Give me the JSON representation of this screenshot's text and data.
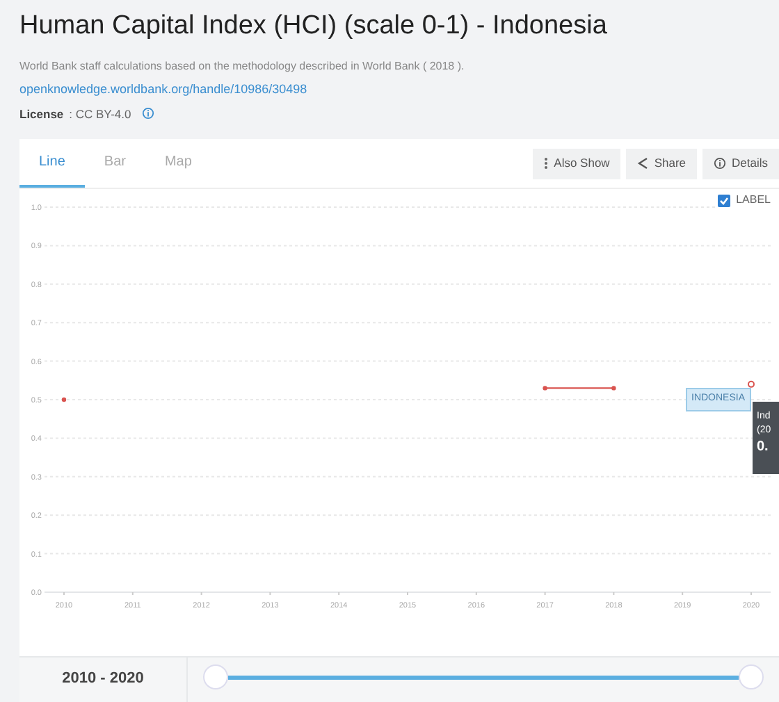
{
  "title": "Human Capital Index (HCI) (scale 0-1) - Indonesia",
  "source": "World Bank staff calculations based on the methodology described in World Bank ( 2018 ).",
  "source_link": "openknowledge.worldbank.org/handle/10986/30498",
  "license": {
    "label": "License",
    "value": ": CC BY-4.0"
  },
  "tabs": [
    {
      "label": "Line",
      "selected": true
    },
    {
      "label": "Bar",
      "selected": false
    },
    {
      "label": "Map",
      "selected": false
    }
  ],
  "actions": [
    {
      "label": "Also Show",
      "kind": "more"
    },
    {
      "label": "Share",
      "kind": "share"
    },
    {
      "label": "Details",
      "kind": "info"
    }
  ],
  "label_toggle": {
    "label": "LABEL",
    "checked": true
  },
  "chart_data": {
    "type": "line",
    "categories": [
      "2010",
      "2011",
      "2012",
      "2013",
      "2014",
      "2015",
      "2016",
      "2017",
      "2018",
      "2019",
      "2020"
    ],
    "grid": true,
    "series": [
      {
        "name": "INDONESIA",
        "marker": "circle",
        "color": "#d9534f",
        "values": [
          0.5,
          null,
          null,
          null,
          null,
          null,
          null,
          0.53,
          0.53,
          null,
          0.54
        ]
      }
    ],
    "ylim": [
      0,
      1
    ],
    "yticks": [
      {
        "value": 0,
        "label": "0.0"
      },
      0.1,
      0.2,
      0.3,
      0.4,
      0.5,
      0.6,
      0.7,
      0.8,
      0.9,
      {
        "value": 1,
        "label": "1.0"
      }
    ]
  },
  "tooltip": [
    "Ind",
    "(20",
    "0."
  ],
  "range": {
    "label": "2010 - 2020",
    "level": 1
  }
}
